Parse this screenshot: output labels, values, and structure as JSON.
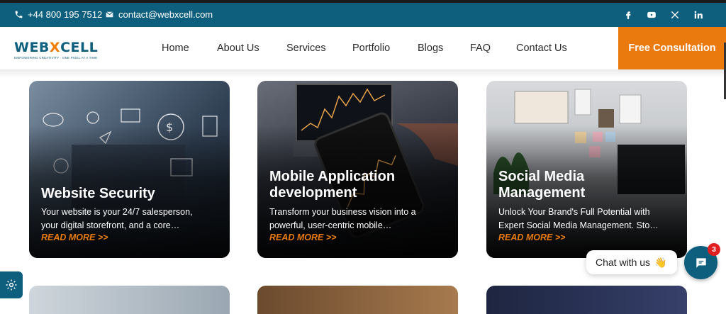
{
  "topbar": {
    "phone": "+44 800 195 7512",
    "email": "contact@webxcell.com",
    "social": [
      "facebook-icon",
      "youtube-icon",
      "x-icon",
      "linkedin-icon"
    ]
  },
  "brand": {
    "name_a": "WEB",
    "name_x": "X",
    "name_b": "CELL",
    "tagline": "EMPOWERING CREATIVITY · ONE PIXEL AT A TIME"
  },
  "nav": {
    "items": [
      "Home",
      "About Us",
      "Services",
      "Portfolio",
      "Blogs",
      "FAQ",
      "Contact Us"
    ],
    "cta": "Free Consultation"
  },
  "cards": [
    {
      "title": "Website Security",
      "desc_line1": "Your website is your 24/7 salesperson,",
      "desc_line2": "your digital storefront, and a core…",
      "more": "READ MORE >>"
    },
    {
      "title_line1": "Mobile Application",
      "title_line2": "development",
      "desc_line1": "Transform your business vision into a",
      "desc_line2": "powerful, user-centric mobile…",
      "more": "READ MORE >>"
    },
    {
      "title_line1": "Social Media",
      "title_line2": "Management",
      "desc_line1": "Unlock Your Brand's Full Potential with",
      "desc_line2": "Expert Social Media Management. Sto…",
      "more": "READ MORE >>"
    }
  ],
  "chat": {
    "label": "Chat with us",
    "emoji": "👋",
    "badge": "3"
  },
  "colors": {
    "primary": "#0e5f7e",
    "accent": "#ea7a0e"
  }
}
